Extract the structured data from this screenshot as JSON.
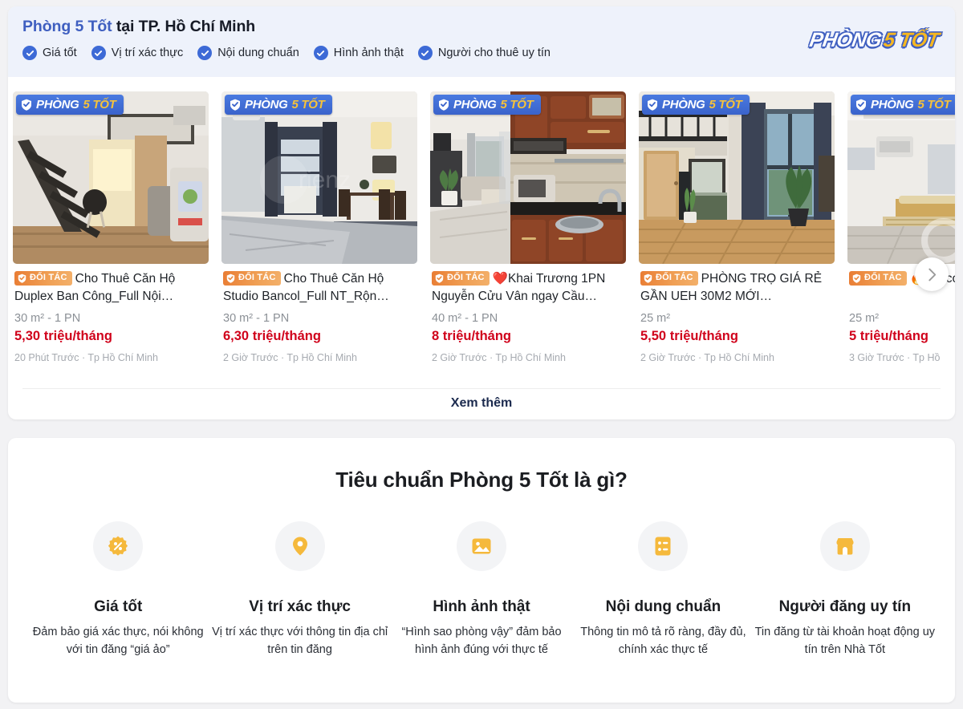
{
  "header": {
    "title_brand": "Phòng 5 Tốt",
    "title_rest": " tại TP. Hồ Chí Minh",
    "checks": [
      {
        "label": "Giá tốt",
        "icon": "check-circle-icon"
      },
      {
        "label": "Vị trí xác thực",
        "icon": "check-circle-icon"
      },
      {
        "label": "Nội dung chuẩn",
        "icon": "check-circle-icon"
      },
      {
        "label": "Hình ảnh thật",
        "icon": "check-circle-icon"
      },
      {
        "label": "Người cho thuê uy tín",
        "icon": "check-circle-icon"
      }
    ],
    "logo": {
      "word1": "PHÒNG",
      "word2": "5 TỐT"
    },
    "colors": {
      "brand_blue": "#3f5fc0",
      "badge_blue": "#3d6ad6",
      "logo_gold": "#f5b721",
      "band_bg": "#eef2fb"
    }
  },
  "carousel": {
    "image_badge": {
      "word1": "PHÒNG",
      "word2": "5 TỐT",
      "icon": "shield-check-icon"
    },
    "partner_badge": {
      "label": "ĐỐI TÁC",
      "icon": "shield-check-icon"
    },
    "next_icon": "chevron-right-icon",
    "more_label": "Xem thêm",
    "cards": [
      {
        "title": "Cho Thuê Căn Hộ Duplex Ban Công_Full Nội…",
        "prefix_emoji": "",
        "meta": "30 m² - 1 PN",
        "price": "5,30 triệu/tháng",
        "time": "20 Phút Trước · Tp Hồ Chí Minh",
        "photo": "duplex-loft-ladder"
      },
      {
        "title": "Cho Thuê Căn Hộ Studio Bancol_Full NT_Rộn…",
        "prefix_emoji": "",
        "meta": "30 m² - 1 PN",
        "price": "6,30 triệu/tháng",
        "time": "2 Giờ Trước · Tp Hồ Chí Minh",
        "photo": "studio-bedroom"
      },
      {
        "title": "Khai Trương 1PN Nguyễn Cửu Vân ngay Cầu…",
        "prefix_emoji": "❤️",
        "meta": "40 m² - 1 PN",
        "price": "8 triệu/tháng",
        "time": "2 Giờ Trước · Tp Hồ Chí Minh",
        "photo": "kitchen-wood-cabinets"
      },
      {
        "title": "PHÒNG TRỌ GIÁ RẺ GẦN UEH 30M2 MỚI…",
        "prefix_emoji": "",
        "meta": "25 m²",
        "price": "5,50 triệu/tháng",
        "time": "2 Giờ Trước · Tp Hồ Chí Minh",
        "photo": "loft-wood-floor-balcony"
      },
      {
        "title": "bancol full nội th",
        "prefix_emoji": "🔥",
        "meta": "25 m²",
        "price": "5 triệu/tháng",
        "time": "3 Giờ Trước · Tp Hồ",
        "photo": "white-room-bed"
      }
    ]
  },
  "standards": {
    "title": "Tiêu chuẩn Phòng 5 Tốt là gì?",
    "accent_color": "#f5b93c",
    "items": [
      {
        "icon": "discount-badge-icon",
        "name": "Giá tốt",
        "desc": "Đảm bảo giá xác thực, nói không với tin đăng “giá ảo”"
      },
      {
        "icon": "location-pin-icon",
        "name": "Vị trí xác thực",
        "desc": "Vị trí xác thực với thông tin địa chỉ trên tin đăng"
      },
      {
        "icon": "image-photo-icon",
        "name": "Hình ảnh thật",
        "desc": "“Hình sao phòng vậy” đảm bảo hình ảnh đúng với thực tế"
      },
      {
        "icon": "checklist-icon",
        "name": "Nội dung chuẩn",
        "desc": "Thông tin mô tả rõ ràng, đầy đủ, chính xác thực tế"
      },
      {
        "icon": "storefront-icon",
        "name": "Người đăng uy tín",
        "desc": "Tin đăng từ tài khoản hoạt động uy tín trên Nhà Tốt"
      }
    ]
  }
}
